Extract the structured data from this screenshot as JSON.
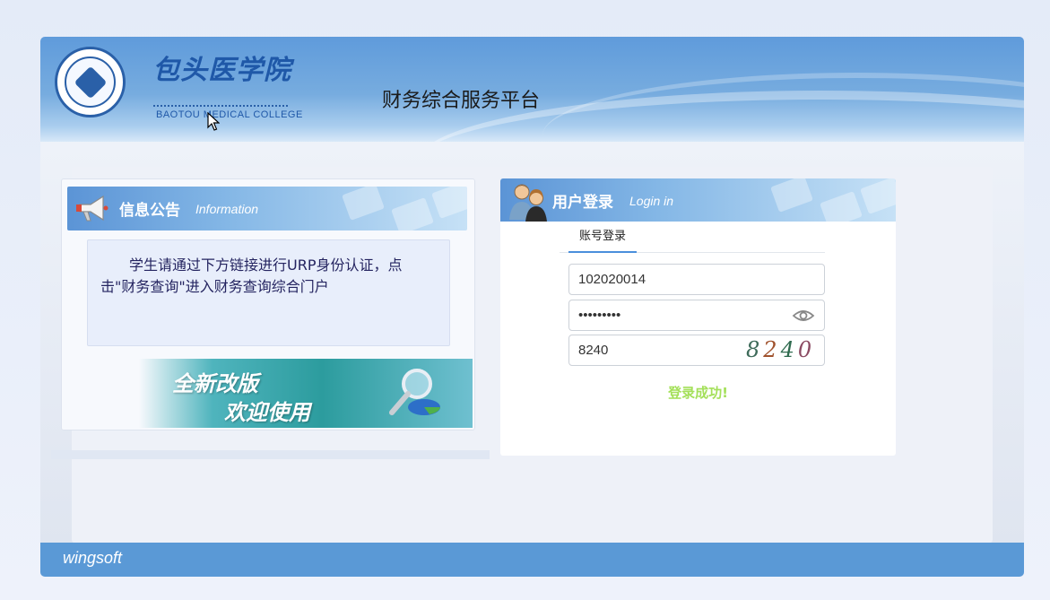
{
  "header": {
    "logo_cn": "包头医学院",
    "logo_en": "BAOTOU MEDICAL COLLEGE",
    "site_title": "财务综合服务平台"
  },
  "notice": {
    "title": "信息公告",
    "subtitle": "Information",
    "body": "学生请通过下方链接进行URP身份认证，点击\"财务查询\"进入财务查询综合门户",
    "banner_line1": "全新改版",
    "banner_line2": "欢迎使用"
  },
  "login": {
    "title": "用户登录",
    "subtitle": "Login in",
    "tab_account": "账号登录",
    "username_value": "102020014",
    "password_value": "•••••••••",
    "captcha_value": "8240",
    "captcha_image_chars": [
      "8",
      "2",
      "4",
      "0"
    ],
    "status_message": "登录成功!"
  },
  "footer": {
    "brand": "wingsoft"
  },
  "colors": {
    "header_blue": "#5f9bdb",
    "footer_blue": "#5a99d6",
    "tab_accent": "#4a8fdc",
    "success_green": "#a4e05a",
    "notice_text": "#242460"
  },
  "icons": {
    "notice": "megaphone-icon",
    "login": "users-icon",
    "password_toggle": "eye-icon",
    "banner": "magnifier-icon"
  }
}
